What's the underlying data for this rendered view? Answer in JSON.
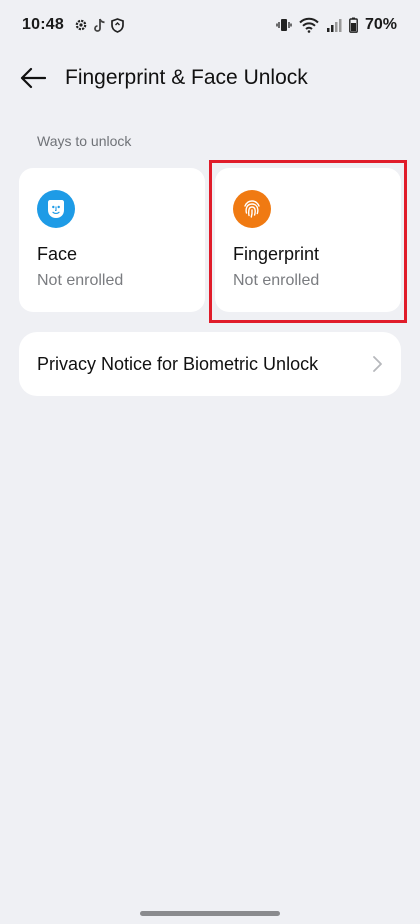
{
  "status_bar": {
    "time": "10:48",
    "battery": "70%",
    "icons": [
      "gear-icon",
      "tiktok-icon",
      "shield-icon",
      "vibrate-icon",
      "wifi-icon",
      "signal-icon",
      "battery-icon"
    ]
  },
  "header": {
    "title": "Fingerprint & Face Unlock",
    "back_icon": "arrow-left-icon"
  },
  "section": {
    "label": "Ways to unlock"
  },
  "tiles": [
    {
      "title": "Face",
      "status": "Not enrolled",
      "icon": "face-icon",
      "icon_color": "#1e9be6"
    },
    {
      "title": "Fingerprint",
      "status": "Not enrolled",
      "icon": "fingerprint-icon",
      "icon_color": "#f07a12",
      "highlighted": true
    }
  ],
  "privacy": {
    "label": "Privacy Notice for Biometric Unlock",
    "icon": "chevron-right-icon"
  },
  "colors": {
    "background": "#eff0f4",
    "highlight": "#e01c2a"
  }
}
